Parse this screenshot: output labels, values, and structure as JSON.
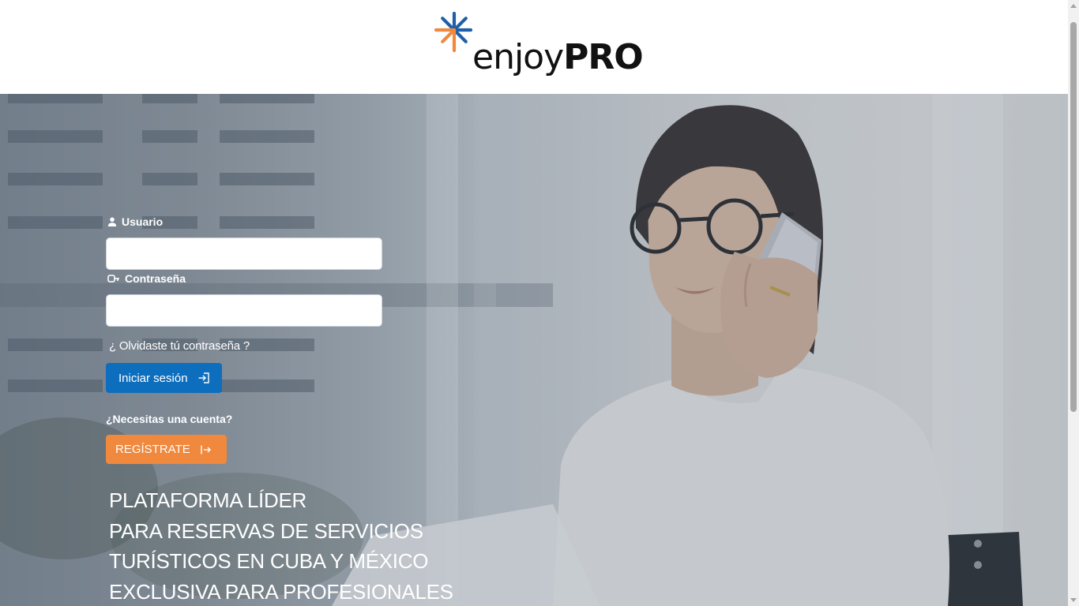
{
  "brand": {
    "name_light": "enjoy",
    "name_bold": "PRO",
    "colors": {
      "mark_blue": "#1f5fa8",
      "mark_orange": "#f0883e",
      "text": "#111111"
    }
  },
  "hero": {
    "image": "woman-on-phone-photo"
  },
  "login_form": {
    "username_label": "Usuario",
    "username_icon": "user-icon",
    "username_value": "",
    "password_label": "Contraseña",
    "password_icon": "key-icon",
    "password_value": "",
    "forgot_password": "¿ Olvidaste tú contraseña ?",
    "login_button": "Iniciar sesión",
    "login_icon": "sign-in-icon",
    "colors": {
      "login_button": "#0d6ebd"
    }
  },
  "register": {
    "prompt": "¿Necesitas una cuenta?",
    "button": "Regístrate",
    "button_icon": "arrow-right-bar-icon",
    "colors": {
      "register_button": "#f0883e"
    }
  },
  "tagline": [
    "PLATAFORMA LÍDER",
    "PARA RESERVAS DE SERVICIOS",
    "TURÍSTICOS EN CUBA Y MÉXICO",
    "EXCLUSIVA PARA PROFESIONALES"
  ]
}
